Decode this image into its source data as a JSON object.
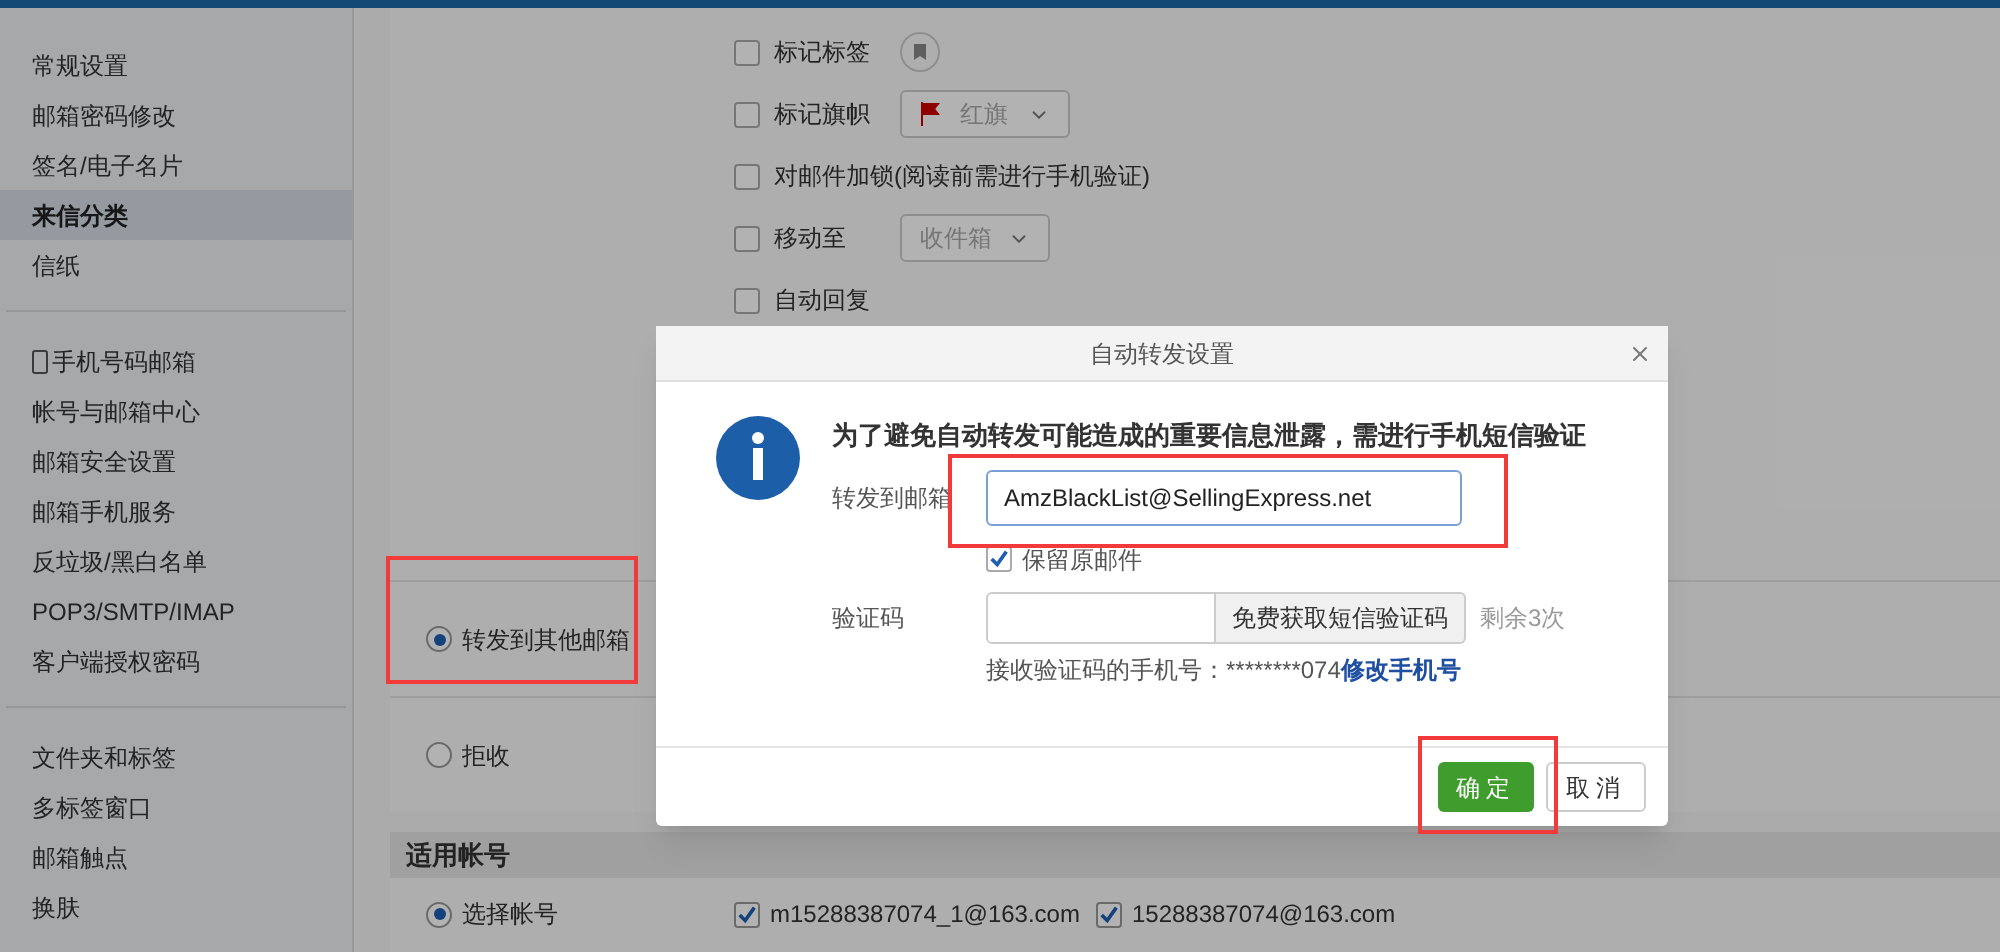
{
  "sidebar": {
    "groups": [
      [
        {
          "label": "常规设置",
          "selected": false,
          "kind": "plain"
        },
        {
          "label": "邮箱密码修改",
          "selected": false,
          "kind": "plain"
        },
        {
          "label": "签名/电子名片",
          "selected": false,
          "kind": "plain"
        },
        {
          "label": "来信分类",
          "selected": true,
          "kind": "plain"
        },
        {
          "label": "信纸",
          "selected": false,
          "kind": "plain"
        }
      ],
      [
        {
          "label": "手机号码邮箱",
          "selected": false,
          "kind": "phone"
        },
        {
          "label": "帐号与邮箱中心",
          "selected": false,
          "kind": "plain"
        },
        {
          "label": "邮箱安全设置",
          "selected": false,
          "kind": "plain"
        },
        {
          "label": "邮箱手机服务",
          "selected": false,
          "kind": "plain"
        },
        {
          "label": "反垃圾/黑白名单",
          "selected": false,
          "kind": "plain"
        },
        {
          "label": "POP3/SMTP/IMAP",
          "selected": false,
          "kind": "plain"
        },
        {
          "label": "客户端授权密码",
          "selected": false,
          "kind": "plain"
        }
      ],
      [
        {
          "label": "文件夹和标签",
          "selected": false,
          "kind": "plain"
        },
        {
          "label": "多标签窗口",
          "selected": false,
          "kind": "plain"
        },
        {
          "label": "邮箱触点",
          "selected": false,
          "kind": "plain"
        },
        {
          "label": "换肤",
          "selected": false,
          "kind": "plain"
        }
      ]
    ]
  },
  "actions": [
    {
      "label": "标记标签",
      "checked": false,
      "kind": "tag"
    },
    {
      "label": "标记旗帜",
      "checked": false,
      "kind": "flag",
      "option": "红旗"
    },
    {
      "label": "对邮件加锁(阅读前需进行手机验证)",
      "checked": false,
      "kind": "plain"
    },
    {
      "label": "移动至",
      "checked": false,
      "kind": "select",
      "option": "收件箱"
    },
    {
      "label": "自动回复",
      "checked": false,
      "kind": "plain"
    }
  ],
  "handling": [
    {
      "label": "转发到其他邮箱",
      "selected": true
    },
    {
      "label": "拒收",
      "selected": false
    }
  ],
  "accounts": {
    "title": "适用帐号",
    "mode": {
      "label": "选择帐号",
      "selected": true
    },
    "emails": [
      {
        "label": "m15288387074_1@163.com",
        "checked": true
      },
      {
        "label": "15288387074@163.com",
        "checked": true
      }
    ]
  },
  "dialog": {
    "title": "自动转发设置",
    "message": "为了避免自动转发可能造成的重要信息泄露，需进行手机短信验证",
    "forward_label": "转发到邮箱",
    "forward_value": "AmzBlackList@SellingExpress.net",
    "keep_original": {
      "label": "保留原邮件",
      "checked": true
    },
    "code_label": "验证码",
    "code_button": "免费获取短信验证码",
    "remaining": "剩余3次",
    "phone_note": "接收验证码的手机号：********074",
    "change_phone_link": "修改手机号",
    "confirm": "确定",
    "cancel": "取消"
  }
}
